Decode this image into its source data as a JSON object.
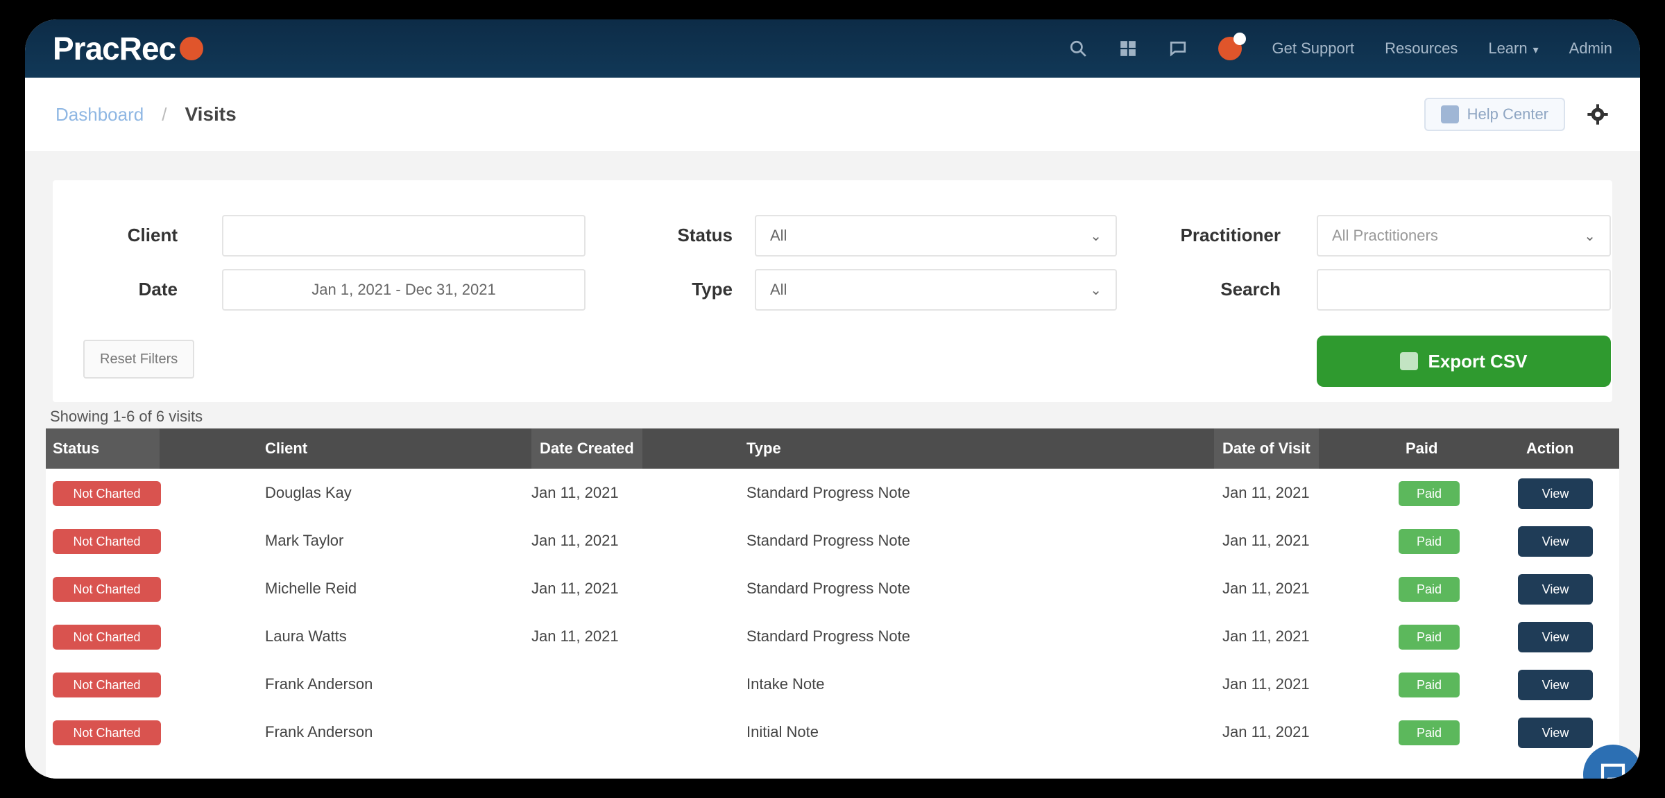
{
  "app": {
    "logo_text": "PracRec"
  },
  "nav": {
    "icons": [
      "search-icon",
      "grid-icon",
      "chat-icon"
    ],
    "links": [
      {
        "label": "Get Support"
      },
      {
        "label": "Resources"
      },
      {
        "label": "Learn"
      },
      {
        "label": "Admin"
      }
    ]
  },
  "breadcrumb": {
    "parent": "Dashboard",
    "separator": "/",
    "current": "Visits"
  },
  "help_button": {
    "label": "Help Center"
  },
  "filters": {
    "client_label": "Client",
    "client_value": "",
    "date_label": "Date",
    "date_value": "Jan 1, 2021 - Dec 31, 2021",
    "status_label": "Status",
    "status_value": "All",
    "type_label": "Type",
    "type_value": "All",
    "practitioner_label": "Practitioner",
    "practitioner_value": "All Practitioners",
    "search_label": "Search",
    "search_value": "",
    "reset_label": "Reset Filters",
    "export_label": "Export CSV"
  },
  "summary": "Showing 1-6 of 6 visits",
  "table": {
    "columns": [
      "Status",
      "Client",
      "Date Created",
      "Type",
      "Date of Visit",
      "Paid",
      "Action"
    ],
    "rows": [
      {
        "status": "Not Charted",
        "client": "Douglas Kay",
        "created": "Jan 11, 2021",
        "type": "Standard Progress Note",
        "visit": "Jan 11, 2021",
        "paid": "Paid",
        "action": "View"
      },
      {
        "status": "Not Charted",
        "client": "Mark Taylor",
        "created": "Jan 11, 2021",
        "type": "Standard Progress Note",
        "visit": "Jan 11, 2021",
        "paid": "Paid",
        "action": "View"
      },
      {
        "status": "Not Charted",
        "client": "Michelle Reid",
        "created": "Jan 11, 2021",
        "type": "Standard Progress Note",
        "visit": "Jan 11, 2021",
        "paid": "Paid",
        "action": "View"
      },
      {
        "status": "Not Charted",
        "client": "Laura Watts",
        "created": "Jan 11, 2021",
        "type": "Standard Progress Note",
        "visit": "Jan 11, 2021",
        "paid": "Paid",
        "action": "View"
      },
      {
        "status": "Not Charted",
        "client": "Frank Anderson",
        "created": "",
        "type": "Intake Note",
        "visit": "Jan 11, 2021",
        "paid": "Paid",
        "action": "View"
      },
      {
        "status": "Not Charted",
        "client": "Frank Anderson",
        "created": "",
        "type": "Initial Note",
        "visit": "Jan 11, 2021",
        "paid": "Paid",
        "action": "View"
      }
    ]
  }
}
